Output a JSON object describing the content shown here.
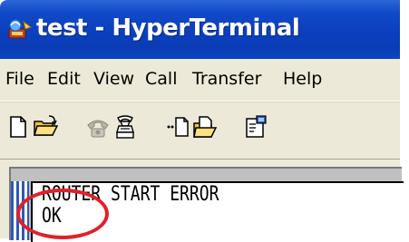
{
  "window": {
    "title": "test - HyperTerminal",
    "title_color": "#0a3cb6"
  },
  "menubar": {
    "items": [
      {
        "label": "File"
      },
      {
        "label": "Edit"
      },
      {
        "label": "View"
      },
      {
        "label": "Call"
      },
      {
        "label": "Transfer"
      },
      {
        "label": "Help"
      }
    ]
  },
  "toolbar": {
    "buttons": [
      {
        "icon": "new-document-icon"
      },
      {
        "icon": "open-folder-icon"
      },
      {
        "icon": "dial-phone-icon"
      },
      {
        "icon": "disconnect-phone-icon"
      },
      {
        "icon": "send-file-icon"
      },
      {
        "icon": "receive-file-icon"
      },
      {
        "icon": "properties-icon"
      }
    ]
  },
  "terminal": {
    "lines": [
      "ROUTER START ERROR",
      "OK"
    ]
  },
  "annotation": {
    "color": "#e0202a"
  }
}
